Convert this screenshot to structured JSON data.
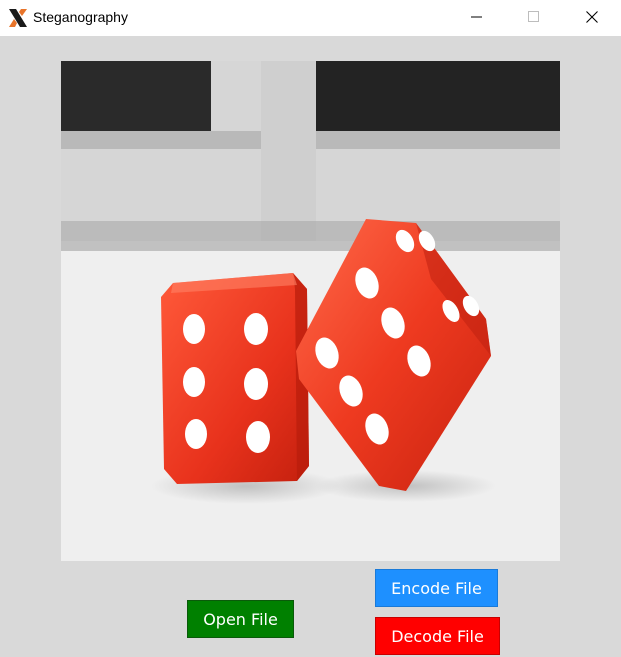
{
  "window": {
    "title": "Steganography",
    "icon": "x-app-icon",
    "controls": [
      "minimize-icon",
      "maximize-icon",
      "close-icon"
    ]
  },
  "main": {
    "image": {
      "subject": "two red dice on a white surface",
      "accent": "#e8321c"
    },
    "buttons": {
      "open_label": "Open File",
      "encode_label": "Encode File",
      "decode_label": "Decode File"
    }
  },
  "colors": {
    "open": "#008000",
    "encode": "#1e90ff",
    "decode": "#ff0000",
    "background": "#d9d9d9"
  }
}
